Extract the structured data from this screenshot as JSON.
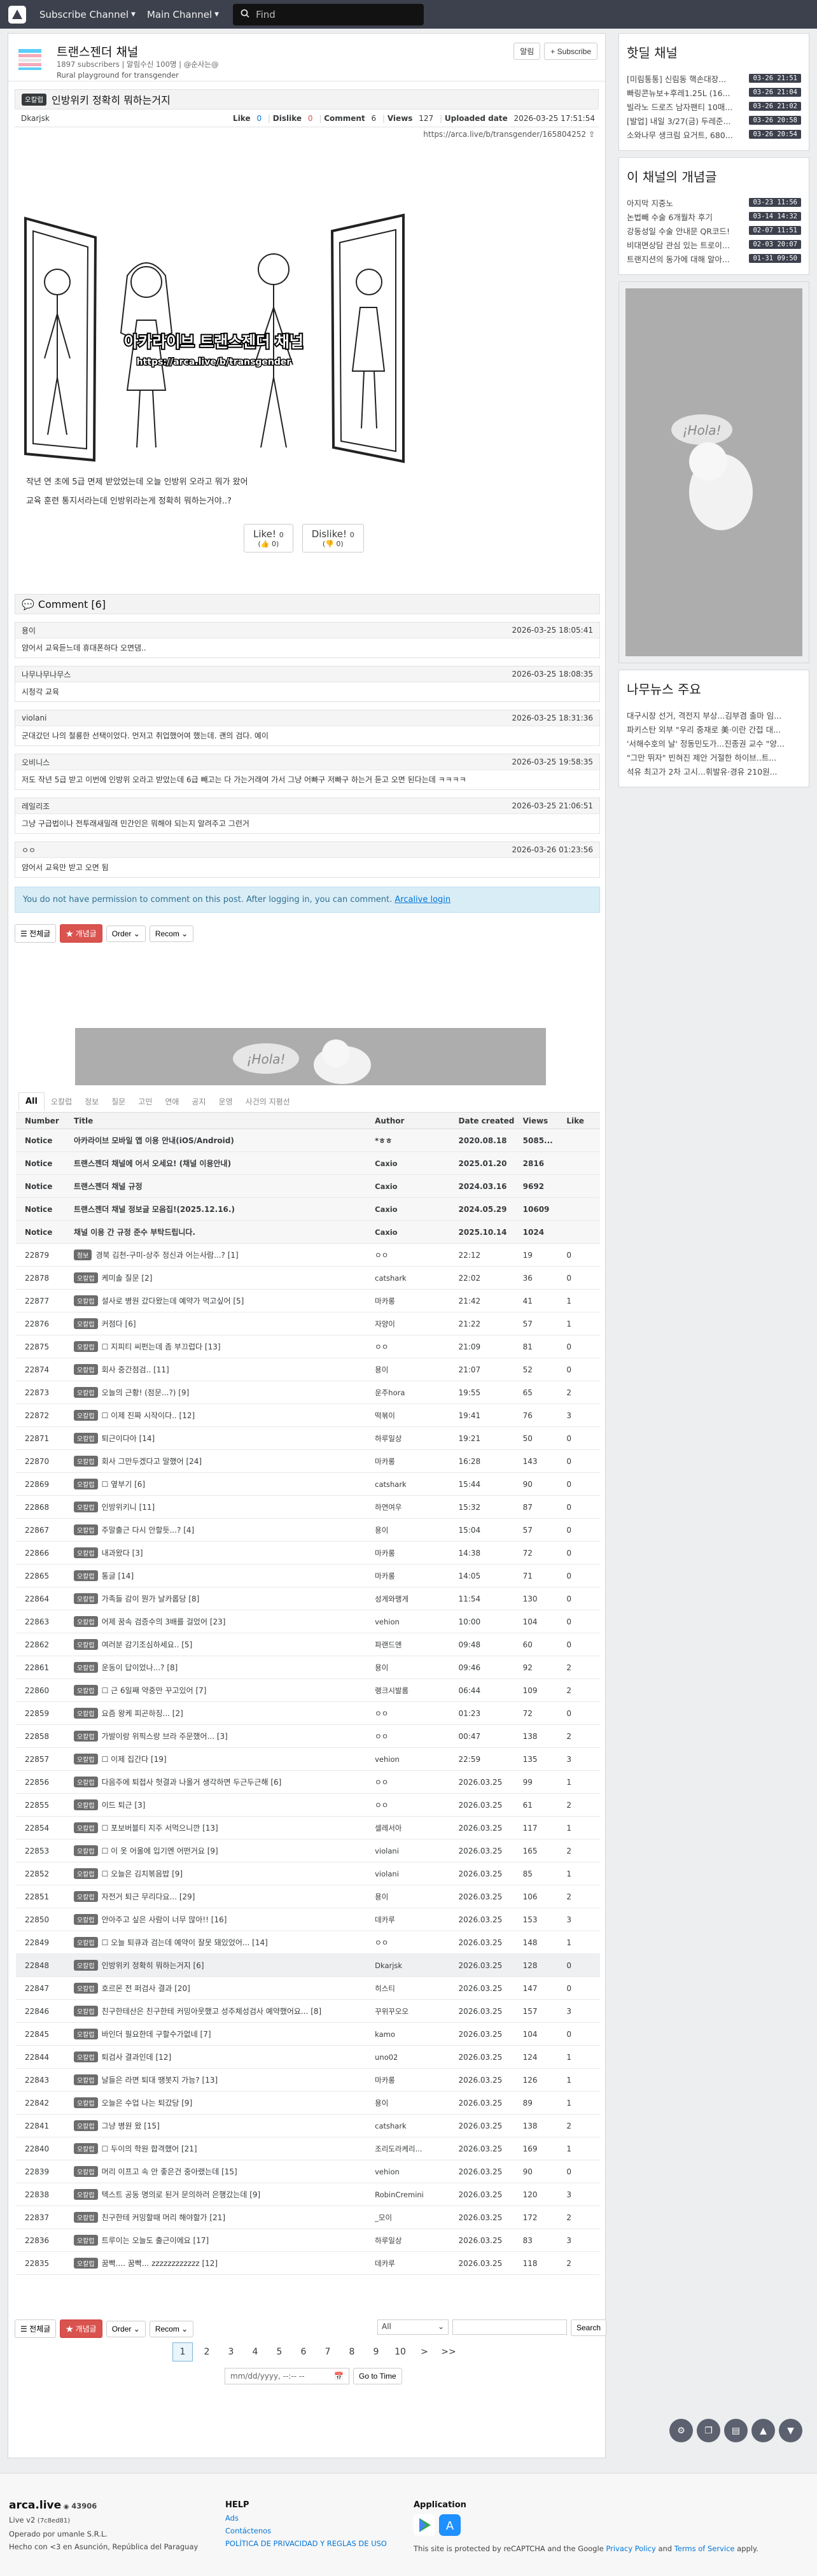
{
  "nav": {
    "subscribe_channel": "Subscribe Channel",
    "main_channel": "Main Channel",
    "search_placeholder": "Find"
  },
  "channel": {
    "name": "트랜스젠더 채널",
    "meta": "1897 subscribers | 알림수신 100명 | @순사는@",
    "desc": "Rural playground for transgender",
    "alarm_label": "알림",
    "subscribe_label": "+ Subscribe"
  },
  "article": {
    "category": "오칼럽",
    "title": "인방위키 정확히 뭐하는거지",
    "author": "Dkarjsk",
    "like_label": "Like",
    "like": "0",
    "dislike_label": "Dislike",
    "dislike": "0",
    "comment_label": "Comment",
    "comment": "6",
    "views_label": "Views",
    "views": "127",
    "uploaded_label": "Uploaded date",
    "uploaded": "2026-03-25 17:51:54",
    "url": "https://arca.live/b/transgender/165804252",
    "body_line1": "작년 연 초에 5급 면제 받았었는데 오늘 인방위 오라고 뭐가 왔어",
    "body_line2": "교육 훈련 통지서라는데 인방위라는게 정확히 뭐하는거야..?",
    "like_btn": "Like!",
    "like_btn_count": "0",
    "like_btn_sub": "0",
    "dislike_btn": "Dislike!",
    "dislike_btn_count": "0",
    "dislike_btn_sub": "0",
    "comic_caption_1": "아카라이브 트랜스젠더 채널",
    "comic_caption_2": "https://arca.live/b/transgender"
  },
  "comments": {
    "header": "Comment [6]",
    "items": [
      {
        "author": "용이",
        "date": "2026-03-25 18:05:41",
        "text": "얌어서 교육듣느데 휴대폰하다 오면댐.."
      },
      {
        "author": "나무나무나무스",
        "date": "2026-03-25 18:08:35",
        "text": "시청각 교육"
      },
      {
        "author": "violani",
        "date": "2026-03-25 18:31:36",
        "text": "군대갔던 나의 철룡한 선택이었다. 먼저고 취업했어여 했는데. 괜의 검다. 예이"
      },
      {
        "author": "오비니스",
        "date": "2026-03-25 19:58:35",
        "text": "저도 작년 5급 받고 이번에 인방위 오라고 받았는데 6급 빼고는 다 가는거래여 가서 그냥 어빠구 저빠구 하는거 듣고 오면 된다는데 ㅋㅋㅋㅋ"
      },
      {
        "author": "레일리조",
        "date": "2026-03-25 21:06:51",
        "text": "그냥 구급법이나 전투래새밀래 민간인은 뭐해야 되는지 알려주고 그런거"
      },
      {
        "author": "ㅇㅇ",
        "date": "2026-03-26 01:23:56",
        "text": "얌어서 교육만 받고 오면 됨"
      }
    ],
    "notice_text": "You do not have permission to comment on this post. After logging in, you can comment.",
    "login_link": "Arcalive login"
  },
  "toolbar": {
    "all": "전체글",
    "best": "개념글",
    "order": "Order",
    "recom": "Recom"
  },
  "tabs": [
    "All",
    "오칼럽",
    "정보",
    "질문",
    "고민",
    "연애",
    "공지",
    "운영",
    "사건의 지평선"
  ],
  "board": {
    "headers": [
      "Number",
      "Title",
      "Author",
      "Date created",
      "Views",
      "Like"
    ],
    "notices": [
      {
        "num": "Notice",
        "title": "아카라이브 모바일 앱 이용 안내(iOS/Android)",
        "author": "*ㅎㅎ",
        "date": "2020.08.18",
        "views": "5085...",
        "like": ""
      },
      {
        "num": "Notice",
        "title": "트랜스젠더 채널에 어서 오세요! (채널 이용안내)",
        "author": "Caxio",
        "date": "2025.01.20",
        "views": "2816",
        "like": ""
      },
      {
        "num": "Notice",
        "title": "트랜스젠더 채널 규정",
        "author": "Caxio",
        "date": "2024.03.16",
        "views": "9692",
        "like": ""
      },
      {
        "num": "Notice",
        "title": "트랜스젠더 채널 정보글 모음집!(2025.12.16.)",
        "author": "Caxio",
        "date": "2024.05.29",
        "views": "10609",
        "like": ""
      },
      {
        "num": "Notice",
        "title": "채널 이용 간 규정 준수 부탁드립니다.",
        "author": "Caxio",
        "date": "2025.10.14",
        "views": "1024",
        "like": ""
      }
    ],
    "rows": [
      {
        "num": "22879",
        "cat": "정보",
        "title": "경북 김천-구미-상주 정신과 어는사람...? [1]",
        "author": "ㅇㅇ",
        "date": "22:12",
        "views": "19",
        "like": "0"
      },
      {
        "num": "22878",
        "cat": "오칼럽",
        "title": "케미솔 질문 [2]",
        "author": "catshark",
        "date": "22:02",
        "views": "36",
        "like": "0"
      },
      {
        "num": "22877",
        "cat": "오칼럽",
        "title": "설사로 병원 갔다왔는데 예약가 먹고싶어 [5]",
        "author": "마카롱",
        "date": "21:42",
        "views": "41",
        "like": "1"
      },
      {
        "num": "22876",
        "cat": "오칼럽",
        "title": "커점다 [6]",
        "author": "자양이",
        "date": "21:22",
        "views": "57",
        "like": "1"
      },
      {
        "num": "22875",
        "cat": "오칼럽",
        "title": "☐ 지피티 씨펀는데 좀 부끄럽다 [13]",
        "author": "ㅇㅇ",
        "date": "21:09",
        "views": "81",
        "like": "0"
      },
      {
        "num": "22874",
        "cat": "오칼럽",
        "title": "회사 중간점검.. [11]",
        "author": "용이",
        "date": "21:07",
        "views": "52",
        "like": "0"
      },
      {
        "num": "22873",
        "cat": "오칼럽",
        "title": "오늘의 근황! (점문...?) [9]",
        "author": "운주hora",
        "date": "19:55",
        "views": "65",
        "like": "2"
      },
      {
        "num": "22872",
        "cat": "오칼럽",
        "title": "☐ 이제 진짜 시작이다.. [12]",
        "author": "떡볶이",
        "date": "19:41",
        "views": "76",
        "like": "3"
      },
      {
        "num": "22871",
        "cat": "오칼럽",
        "title": "퇴근이다아 [14]",
        "author": "하루일상",
        "date": "19:21",
        "views": "50",
        "like": "0"
      },
      {
        "num": "22870",
        "cat": "오칼럽",
        "title": "회사 그만두겠다고 말했어 [24]",
        "author": "마카롱",
        "date": "16:28",
        "views": "143",
        "like": "0"
      },
      {
        "num": "22869",
        "cat": "오칼럽",
        "title": "☐ 옆부기 [6]",
        "author": "catshark",
        "date": "15:44",
        "views": "90",
        "like": "0"
      },
      {
        "num": "22868",
        "cat": "오칼럽",
        "title": "인방위키니 [11]",
        "author": "하연여우",
        "date": "15:32",
        "views": "87",
        "like": "0"
      },
      {
        "num": "22867",
        "cat": "오칼럽",
        "title": "주말출근 다시 안할듯...? [4]",
        "author": "용이",
        "date": "15:04",
        "views": "57",
        "like": "0"
      },
      {
        "num": "22866",
        "cat": "오칼럽",
        "title": "내과왔다 [3]",
        "author": "마카롱",
        "date": "14:38",
        "views": "72",
        "like": "0"
      },
      {
        "num": "22865",
        "cat": "오칼럽",
        "title": "통글 [14]",
        "author": "마카롱",
        "date": "14:05",
        "views": "71",
        "like": "0"
      },
      {
        "num": "22864",
        "cat": "오칼럽",
        "title": "가족들 감이 뭔가 날카롭당 [8]",
        "author": "성게와맹게",
        "date": "11:54",
        "views": "130",
        "like": "0"
      },
      {
        "num": "22863",
        "cat": "오칼럽",
        "title": "어제 꿈속 검증수의 3배를 걸었어 [23]",
        "author": "vehion",
        "date": "10:00",
        "views": "104",
        "like": "0"
      },
      {
        "num": "22862",
        "cat": "오칼럽",
        "title": "여러분 감기조심하세요.. [5]",
        "author": "파랜드앤",
        "date": "09:48",
        "views": "60",
        "like": "0"
      },
      {
        "num": "22861",
        "cat": "오칼럽",
        "title": "운동이 답이었나...? [8]",
        "author": "용이",
        "date": "09:46",
        "views": "92",
        "like": "2"
      },
      {
        "num": "22860",
        "cat": "오칼럽",
        "title": "☐ 근 6일째 약중만 꾸고있어 [7]",
        "author": "랭크시발롬",
        "date": "06:44",
        "views": "109",
        "like": "2"
      },
      {
        "num": "22859",
        "cat": "오칼럽",
        "title": "요즘 왕케 피곤하징... [2]",
        "author": "ㅇㅇ",
        "date": "01:23",
        "views": "72",
        "like": "0"
      },
      {
        "num": "22858",
        "cat": "오칼럽",
        "title": "가발이랑 위픽스랑 브라 주문했어... [3]",
        "author": "ㅇㅇ",
        "date": "00:47",
        "views": "138",
        "like": "2"
      },
      {
        "num": "22857",
        "cat": "오칼럽",
        "title": "☐ 이제 집간다 [19]",
        "author": "vehion",
        "date": "22:59",
        "views": "135",
        "like": "3"
      },
      {
        "num": "22856",
        "cat": "오칼럽",
        "title": "다음주에 퇴접사 헛결과 나올거 생각하면 두근두근해 [6]",
        "author": "ㅇㅇ",
        "date": "2026.03.25",
        "views": "99",
        "like": "1"
      },
      {
        "num": "22855",
        "cat": "오칼럽",
        "title": "이드 퇴근 [3]",
        "author": "ㅇㅇ",
        "date": "2026.03.25",
        "views": "61",
        "like": "2"
      },
      {
        "num": "22854",
        "cat": "오칼럽",
        "title": "☐ 포보버블티 지주 서먹으니깐 [13]",
        "author": "셀레서아",
        "date": "2026.03.25",
        "views": "117",
        "like": "1"
      },
      {
        "num": "22853",
        "cat": "오칼럽",
        "title": "☐ 이 옷 어울에 입기엔 어떤거요 [9]",
        "author": "violani",
        "date": "2026.03.25",
        "views": "165",
        "like": "2"
      },
      {
        "num": "22852",
        "cat": "오칼럽",
        "title": "☐ 오늘은 김치볶음밥 [9]",
        "author": "violani",
        "date": "2026.03.25",
        "views": "85",
        "like": "1"
      },
      {
        "num": "22851",
        "cat": "오칼럽",
        "title": "자전거 퇴근 무리다요... [29]",
        "author": "용이",
        "date": "2026.03.25",
        "views": "106",
        "like": "2"
      },
      {
        "num": "22850",
        "cat": "오칼럽",
        "title": "안아주고 싶은 사람이 너무 많아!! [16]",
        "author": "데카루",
        "date": "2026.03.25",
        "views": "153",
        "like": "3"
      },
      {
        "num": "22849",
        "cat": "오칼럽",
        "title": "☐ 오늘 퇴큐과 검는데 예약이 잘못 돼있었어... [14]",
        "author": "ㅇㅇ",
        "date": "2026.03.25",
        "views": "148",
        "like": "1"
      },
      {
        "num": "22848",
        "cat": "오칼럽",
        "title": "인방위키 정확히 뭐하는거지 [6]",
        "author": "Dkarjsk",
        "date": "2026.03.25",
        "views": "128",
        "like": "0",
        "hl": true
      },
      {
        "num": "22847",
        "cat": "오칼럽",
        "title": "호르몬 전 퍼검사 결과 [20]",
        "author": "히스티",
        "date": "2026.03.25",
        "views": "147",
        "like": "0"
      },
      {
        "num": "22846",
        "cat": "오칼럽",
        "title": "친구한테산은 친구한테 커밍아웃했고 성주체성검사 예약했어요... [8]",
        "author": "꾸위꾸오오",
        "date": "2026.03.25",
        "views": "157",
        "like": "3"
      },
      {
        "num": "22845",
        "cat": "오칼럽",
        "title": "바인더 필요한데 구할수가없네 [7]",
        "author": "kamo",
        "date": "2026.03.25",
        "views": "104",
        "like": "0"
      },
      {
        "num": "22844",
        "cat": "오칼럽",
        "title": "퇴검사 결과인데 [12]",
        "author": "uno02",
        "date": "2026.03.25",
        "views": "124",
        "like": "1"
      },
      {
        "num": "22843",
        "cat": "오칼럽",
        "title": "날들은 라면 퇴대 땡봇지 가능? [13]",
        "author": "마카롱",
        "date": "2026.03.25",
        "views": "126",
        "like": "1"
      },
      {
        "num": "22842",
        "cat": "오칼럽",
        "title": "오늘은 수업 나는 퇴갔당 [9]",
        "author": "용이",
        "date": "2026.03.25",
        "views": "89",
        "like": "1"
      },
      {
        "num": "22841",
        "cat": "오칼럽",
        "title": "그냥 병원 왔 [15]",
        "author": "catshark",
        "date": "2026.03.25",
        "views": "138",
        "like": "2"
      },
      {
        "num": "22840",
        "cat": "오칼럽",
        "title": "☐ 두이의 학원 합격했어 [21]",
        "author": "조리도라케리...",
        "date": "2026.03.25",
        "views": "169",
        "like": "1"
      },
      {
        "num": "22839",
        "cat": "오칼럽",
        "title": "머리 이프고 속 안 좋은건 중아랬는데 [15]",
        "author": "vehion",
        "date": "2026.03.25",
        "views": "90",
        "like": "0"
      },
      {
        "num": "22838",
        "cat": "오칼럽",
        "title": "텍스트 공동 명의로 된거 문의하러 은행갔는데 [9]",
        "author": "RobinCremini",
        "date": "2026.03.25",
        "views": "120",
        "like": "3"
      },
      {
        "num": "22837",
        "cat": "오칼럽",
        "title": "친구한테 커밍할때 머리 해야할가 [21]",
        "author": "_모이",
        "date": "2026.03.25",
        "views": "172",
        "like": "2"
      },
      {
        "num": "22836",
        "cat": "오칼럽",
        "title": "트루이는 오늘도 출근이에요 [17]",
        "author": "하루일상",
        "date": "2026.03.25",
        "views": "83",
        "like": "3"
      },
      {
        "num": "22835",
        "cat": "오칼럽",
        "title": "꿈빡.... 꿈빡... zzzzzzzzzzzz [12]",
        "author": "데카루",
        "date": "2026.03.25",
        "views": "118",
        "like": "2"
      }
    ]
  },
  "search": {
    "scope": "All",
    "button": "Search"
  },
  "pagination": {
    "pages": [
      "1",
      "2",
      "3",
      "4",
      "5",
      "6",
      "7",
      "8",
      "9",
      "10"
    ],
    "current": "1",
    "next": ">",
    "last": ">>"
  },
  "goto": {
    "placeholder": "mm/dd/yyyy, --:-- --",
    "button": "Go to Time"
  },
  "sidebar": {
    "hot_title": "핫딜 채널",
    "hot_items": [
      {
        "title": "[미림통통] 신림동 핵손대장...",
        "time": "03-26 21:51"
      },
      {
        "title": "빠링콘뉴보+후레1.25L (16...",
        "time": "03-26 21:04"
      },
      {
        "title": "빌라노 드로즈 남자팬티 10매...",
        "time": "03-26 21:02"
      },
      {
        "title": "[발업] 내일 3/27(금) 두레준...",
        "time": "03-26 20:58"
      },
      {
        "title": "소와나무 생크림 요거트, 680...",
        "time": "03-26 20:54"
      }
    ],
    "concept_title": "이 채널의 개념글",
    "concept_items": [
      {
        "title": "아지막 지중노",
        "time": "03-23 11:56"
      },
      {
        "title": "논법빼 수술 6개월차 후기",
        "time": "03-14 14:32"
      },
      {
        "title": "강동성일 수술 안내문 QR코드!",
        "time": "02-07 11:51"
      },
      {
        "title": "비대면상담 관심 있는 트로이...",
        "time": "02-03 20:07"
      },
      {
        "title": "트랜지션의 동가에 대해 알아...",
        "time": "01-31 09:50"
      }
    ],
    "news_title": "나무뉴스 주요",
    "news_items": [
      "대구시장 선거, 격전지 부상...김부겸 출마 임...",
      "파키스탄 외부 \"우리 중재로 美·이란 간접 대...",
      "'서해수호의 날' 정동민도가...진종권 교수 \"양...",
      "\"그만 뛰자\" 빈혀진 제안 거절한 하이브..트...",
      "석유 최고가 2차 고시...휘발유·경유 210원..."
    ],
    "ad_text": "¡Hola!"
  },
  "footer": {
    "brand": "arca.live",
    "online": "43906",
    "version": "Live v2",
    "version_hash": "(7c8ed81)",
    "operated": "Operado por umanle S.R.L.",
    "hecho": "Hecho con <3 en Asunción, República del Paraguay",
    "help_title": "HELP",
    "help_links": [
      "Ads",
      "Contáctenos",
      "POLÍTICA DE PRIVACIDAD Y REGLAS DE USO"
    ],
    "app_title": "Application",
    "recaptcha": "This site is protected by reCAPTCHA and the Google",
    "privacy": "Privacy Policy",
    "and": "and",
    "terms": "Terms of Service",
    "apply": "apply."
  }
}
